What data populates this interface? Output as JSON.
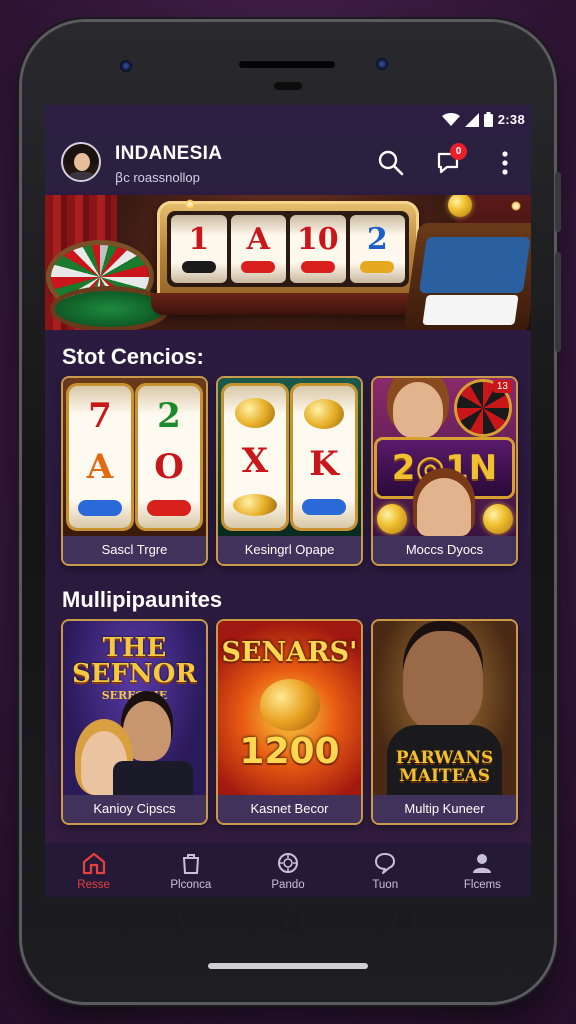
{
  "status_bar": {
    "time": "2:38"
  },
  "header": {
    "title": "INDANESIA",
    "subtitle": "ꞵc roassnollop",
    "notification_count": "0"
  },
  "banner": {
    "reels": [
      "1",
      "A",
      "10",
      "2"
    ]
  },
  "slot_section": {
    "title": "Stot Cencios:",
    "games": [
      {
        "label": "Sascl Trgre",
        "reel1": [
          "7",
          "A"
        ],
        "reel2": [
          "2",
          "O"
        ]
      },
      {
        "label": "Kesingrl Opape",
        "reel1": [
          "X"
        ],
        "reel2": [
          "K"
        ]
      },
      {
        "label": "Moccs Dyocs",
        "art_text": "2◎1N",
        "badge": "13"
      }
    ]
  },
  "multi_section": {
    "title": "Mullipipaunites",
    "games": [
      {
        "label": "Kanioy Cipscs",
        "art_title": "THE SEFNOR",
        "art_sub": "SERFORIE"
      },
      {
        "label": "Kasnet Becor",
        "art_title": "SENARS'",
        "art_value": "1200"
      },
      {
        "label": "Multip Kuneer",
        "art_title": "PARWANS MAITEAS"
      }
    ]
  },
  "bottom_nav": [
    {
      "label": "Resse",
      "icon": "home-icon",
      "active": true
    },
    {
      "label": "Plconca",
      "icon": "shopping-bag-icon",
      "active": false
    },
    {
      "label": "Pando",
      "icon": "chip-icon",
      "active": false
    },
    {
      "label": "Tuon",
      "icon": "chat-bubble-icon",
      "active": false
    },
    {
      "label": "Flcems",
      "icon": "profile-icon",
      "active": false
    }
  ],
  "colors": {
    "accent": "#e8403a",
    "badge": "#e8202a",
    "card_border": "#c89a4a",
    "nav_bg": "#241a38",
    "screen_bg": "#2a1a3e"
  }
}
